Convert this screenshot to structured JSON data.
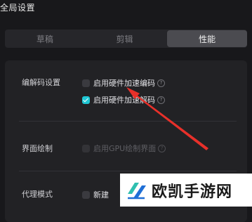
{
  "window": {
    "title": "全局设置"
  },
  "tabs": [
    {
      "label": "草稿",
      "active": false
    },
    {
      "label": "剪辑",
      "active": false
    },
    {
      "label": "性能",
      "active": true
    }
  ],
  "sections": {
    "codec": {
      "label": "编解码设置",
      "options": [
        {
          "label": "启用硬件加速编码",
          "checked": false
        },
        {
          "label": "启用硬件加速解码",
          "checked": true
        }
      ]
    },
    "render": {
      "label": "界面绘制",
      "options": [
        {
          "label": "启用GPU绘制界面",
          "checked": false,
          "disabled": true
        }
      ]
    },
    "proxy": {
      "label": "代理模式",
      "options": [
        {
          "label": "新建",
          "checked": false
        }
      ]
    }
  },
  "watermark": {
    "text": "欧凯手游网"
  },
  "colors": {
    "accent": "#1fc7d4",
    "arrow": "#e8302a",
    "background": "#18181b"
  }
}
